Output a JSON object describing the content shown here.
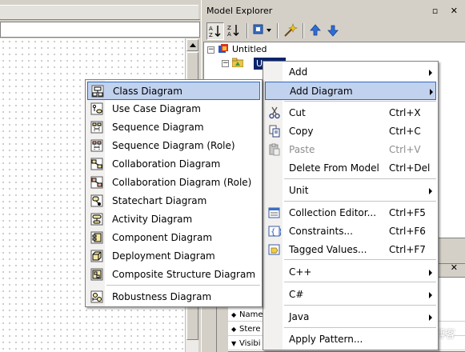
{
  "explorer": {
    "title": "Model Explorer",
    "window_buttons": "▫ ✕",
    "toolbar_icons": [
      "sort-alpha-icon",
      "sort-type-icon",
      "filter-dropdown-icon",
      "wand-icon",
      "move-up-icon",
      "move-down-icon"
    ],
    "tree": {
      "root_label": "Untitled",
      "selected_label": "Un"
    },
    "props_window_buttons": "▫ ✕",
    "property_rows": [
      "Name",
      "Stere",
      "Visibi"
    ],
    "watermark": "@51CTO博客"
  },
  "context_menu": {
    "items": [
      {
        "label": "Add",
        "accel": "",
        "submenu": true,
        "disabled": false
      },
      {
        "label": "Add Diagram",
        "accel": "",
        "submenu": true,
        "disabled": false,
        "highlighted": true
      },
      {
        "label": "Cut",
        "accel": "Ctrl+X",
        "submenu": false,
        "disabled": false,
        "icon": "scissors-icon"
      },
      {
        "label": "Copy",
        "accel": "Ctrl+C",
        "submenu": false,
        "disabled": false,
        "icon": "copy-icon"
      },
      {
        "label": "Paste",
        "accel": "Ctrl+V",
        "submenu": false,
        "disabled": true,
        "icon": "paste-icon"
      },
      {
        "label": "Delete From Model",
        "accel": "Ctrl+Del",
        "submenu": false,
        "disabled": false
      },
      {
        "label": "Unit",
        "accel": "",
        "submenu": true,
        "disabled": false
      },
      {
        "label": "Collection Editor...",
        "accel": "Ctrl+F5",
        "submenu": false,
        "disabled": false,
        "icon": "collection-editor-icon"
      },
      {
        "label": "Constraints...",
        "accel": "Ctrl+F6",
        "submenu": false,
        "disabled": false,
        "icon": "constraints-icon"
      },
      {
        "label": "Tagged Values...",
        "accel": "Ctrl+F7",
        "submenu": false,
        "disabled": false,
        "icon": "tagged-values-icon"
      },
      {
        "label": "C++",
        "accel": "",
        "submenu": true,
        "disabled": false
      },
      {
        "label": "C#",
        "accel": "",
        "submenu": true,
        "disabled": false
      },
      {
        "label": "Java",
        "accel": "",
        "submenu": true,
        "disabled": false
      },
      {
        "label": "Apply Pattern...",
        "accel": "",
        "submenu": false,
        "disabled": false
      }
    ]
  },
  "diagram_menu": {
    "items": [
      {
        "label": "Class Diagram",
        "icon": "class-diagram-icon",
        "highlighted": true
      },
      {
        "label": "Use Case Diagram",
        "icon": "use-case-diagram-icon"
      },
      {
        "label": "Sequence Diagram",
        "icon": "sequence-diagram-icon"
      },
      {
        "label": "Sequence Diagram (Role)",
        "icon": "sequence-role-diagram-icon"
      },
      {
        "label": "Collaboration Diagram",
        "icon": "collaboration-diagram-icon"
      },
      {
        "label": "Collaboration Diagram (Role)",
        "icon": "collaboration-role-diagram-icon"
      },
      {
        "label": "Statechart Diagram",
        "icon": "statechart-diagram-icon"
      },
      {
        "label": "Activity Diagram",
        "icon": "activity-diagram-icon"
      },
      {
        "label": "Component Diagram",
        "icon": "component-diagram-icon"
      },
      {
        "label": "Deployment Diagram",
        "icon": "deployment-diagram-icon"
      },
      {
        "label": "Composite Structure Diagram",
        "icon": "composite-structure-diagram-icon"
      },
      {
        "label": "Robustness Diagram",
        "icon": "robustness-diagram-icon"
      }
    ]
  },
  "colors": {
    "menu_highlight": "#c1d2ee",
    "menu_highlight_border": "#316ac5",
    "window_face": "#d4d0c8",
    "tree_selection": "#0a246a"
  }
}
